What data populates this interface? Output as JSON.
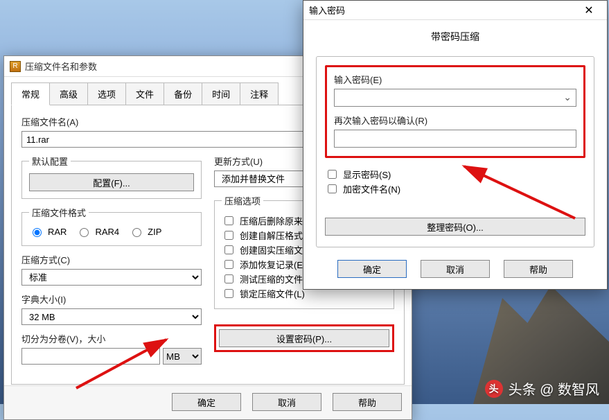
{
  "mainDialog": {
    "title": "压缩文件名和参数",
    "tabs": [
      "常规",
      "高级",
      "选项",
      "文件",
      "备份",
      "时间",
      "注释"
    ],
    "activeTab": 0,
    "archiveNameLabel": "压缩文件名(A)",
    "archiveName": "11.rar",
    "defaultProfileLabel": "默认配置",
    "profileButton": "配置(F)...",
    "updateModeLabel": "更新方式(U)",
    "updateMode": "添加并替换文件",
    "formatLabel": "压缩文件格式",
    "formats": [
      "RAR",
      "RAR4",
      "ZIP"
    ],
    "formatSelected": "RAR",
    "methodLabel": "压缩方式(C)",
    "method": "标准",
    "dictLabel": "字典大小(I)",
    "dict": "32 MB",
    "splitLabel": "切分为分卷(V)，大小",
    "splitValue": "",
    "splitUnit": "MB",
    "optionsLabel": "压缩选项",
    "options": [
      "压缩后删除原来的文件",
      "创建自解压格式压缩文件",
      "创建固实压缩文件(S)",
      "添加恢复记录(E)",
      "测试压缩的文件(T)",
      "锁定压缩文件(L)"
    ],
    "setPasswordButton": "设置密码(P)...",
    "ok": "确定",
    "cancel": "取消",
    "help": "帮助"
  },
  "pwdDialog": {
    "windowTitle": "输入密码",
    "heading": "带密码压缩",
    "enterLabel": "输入密码(E)",
    "enterValue": "",
    "confirmLabel": "再次输入密码以确认(R)",
    "confirmValue": "",
    "showPassword": "显示密码(S)",
    "encryptNames": "加密文件名(N)",
    "organizeButton": "整理密码(O)...",
    "ok": "确定",
    "cancel": "取消",
    "help": "帮助"
  },
  "watermark": "头条 @ 数智风"
}
